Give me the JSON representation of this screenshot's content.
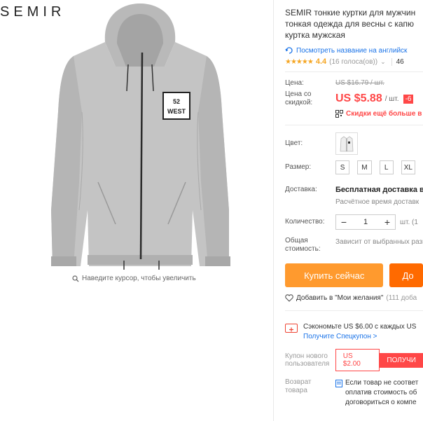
{
  "brand": "SEMIR",
  "zoom_hint": "Наведите курсор, чтобы увеличить",
  "product": {
    "title_lines": [
      "SEMIR тонкие куртки для мужчин",
      "тонкая одежда для весны с капю",
      "куртка мужская"
    ],
    "translate_link": "Посмотреть название на английск",
    "rating_value": "4.4",
    "votes": "(16 голоса(ов))",
    "orders": "46",
    "patch_line1": "52",
    "patch_line2": "WEST"
  },
  "price": {
    "label": "Цена:",
    "old": "US $16.79 / шт.",
    "sale_label": "Цена со скидкой:",
    "sale": "US $5.88",
    "per_unit": "/ шт.",
    "discount_badge": "-6",
    "coupon_text": "Скидки ещё больше в"
  },
  "color": {
    "label": "Цвет:"
  },
  "size": {
    "label": "Размер:",
    "options": [
      "S",
      "M",
      "L",
      "XL"
    ]
  },
  "shipping": {
    "label": "Доставка:",
    "main": "Бесплатная доставка в",
    "sub": "Расчётное время доставк"
  },
  "quantity": {
    "label": "Количество:",
    "value": "1",
    "minus": "−",
    "plus": "+",
    "unit": "шт. (1"
  },
  "total": {
    "label": "Общая стоимость:",
    "note": "Зависит от выбранных разм"
  },
  "buttons": {
    "buy": "Купить сейчас",
    "cart": "До"
  },
  "wishlist": {
    "label": "Добавить в \"Мои желания\"",
    "count": "(111 доба"
  },
  "saving": {
    "text": "Сэкономьте US $6.00 с каждых US",
    "link": "Получите Спецкупон >"
  },
  "new_coupon": {
    "label": "Купон нового пользователя",
    "value": "US $2.00",
    "get": "ПОЛУЧИ"
  },
  "returns": {
    "label": "Возврат товара",
    "lines": [
      "Если товар не соответ",
      "оплатив стоимость об",
      "договориться о компе"
    ]
  },
  "colors": {
    "accent": "#ff4747",
    "buy": "#ff9a2e",
    "cart": "#ff6a00",
    "link": "#1a73e8",
    "star": "#f5a623"
  }
}
